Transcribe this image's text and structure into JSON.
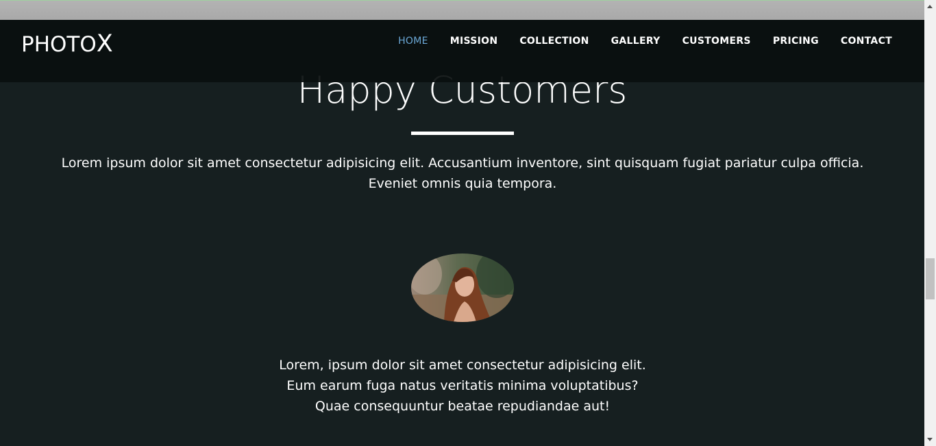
{
  "brand": {
    "logo_main": "PHOTO",
    "logo_x": "X"
  },
  "nav": {
    "items": [
      {
        "label": "HOME",
        "active": true
      },
      {
        "label": "MISSION",
        "active": false
      },
      {
        "label": "COLLECTION",
        "active": false
      },
      {
        "label": "GALLERY",
        "active": false
      },
      {
        "label": "CUSTOMERS",
        "active": false
      },
      {
        "label": "PRICING",
        "active": false
      },
      {
        "label": "CONTACT",
        "active": false
      }
    ]
  },
  "section": {
    "title": "Happy Customers",
    "intro": "Lorem ipsum dolor sit amet consectetur adipisicing elit. Accusantium inventore, sint quisquam fugiat pariatur culpa officia. Eveniet omnis quia tempora."
  },
  "testimonial": {
    "lines": [
      "Lorem, ipsum dolor sit amet consectetur adipisicing elit.",
      "Eum earum fuga natus veritatis minima voluptatibus?",
      "Quae consequuntur beatae repudiandae aut!"
    ]
  },
  "colors": {
    "background": "#161f20",
    "navbar": "#0a0f0f",
    "active_link": "#6ca9d8",
    "text": "#ffffff"
  },
  "icons": {
    "scroll_up": "chevron-up-icon",
    "scroll_down": "chevron-down-icon"
  }
}
